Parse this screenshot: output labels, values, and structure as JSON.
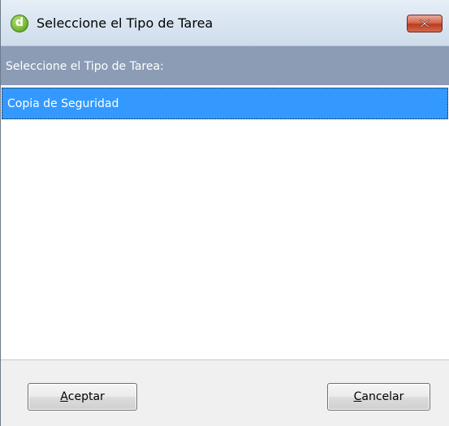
{
  "window": {
    "title": "Seleccione el Tipo de Tarea",
    "app_icon_letter": "d",
    "close_icon": "close-x-icon"
  },
  "header": {
    "label": "Seleccione el Tipo de Tarea:"
  },
  "list": {
    "items": [
      {
        "label": "Copia de Seguridad",
        "selected": true
      }
    ]
  },
  "footer": {
    "accept": {
      "mnemonic": "A",
      "rest": "ceptar"
    },
    "cancel": {
      "mnemonic": "C",
      "rest": "ancelar"
    }
  },
  "colors": {
    "header_band": "#8c9cb5",
    "selection": "#3399ff",
    "close_button": "#c0391f"
  }
}
